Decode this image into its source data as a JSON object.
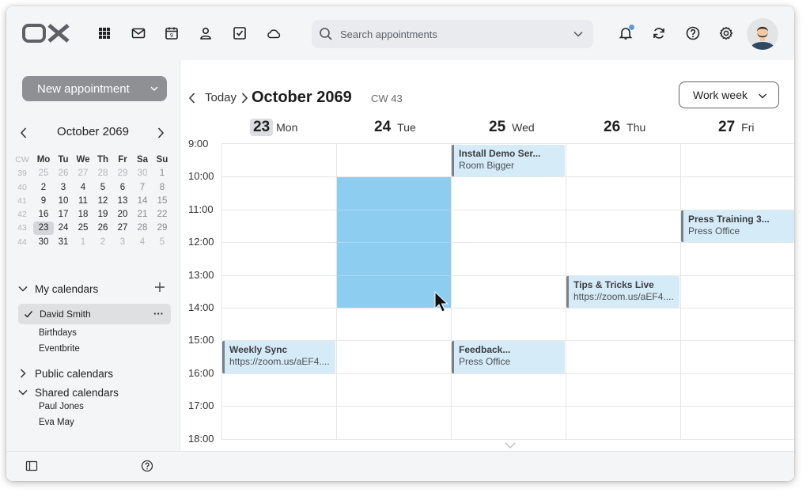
{
  "topbar": {
    "logo_text": "OX",
    "nav_icons": [
      "apps-grid-icon",
      "mail-icon",
      "calendar-icon",
      "contacts-icon",
      "tasks-icon",
      "drive-cloud-icon"
    ],
    "calendar_icon_day": "9",
    "search": {
      "placeholder": "Search appointments"
    },
    "right_icons": [
      "bell-icon",
      "refresh-icon",
      "help-icon",
      "settings-gear-icon"
    ]
  },
  "sidebar": {
    "new_appointment_label": "New appointment",
    "mini_calendar": {
      "title": "October 2069",
      "cw_header": "CW",
      "weekday_headers": [
        "Mo",
        "Tu",
        "We",
        "Th",
        "Fr",
        "Sa",
        "Su"
      ],
      "weeks": [
        {
          "cw": "39",
          "days": [
            "25",
            "26",
            "27",
            "28",
            "29",
            "30",
            "1"
          ]
        },
        {
          "cw": "40",
          "days": [
            "2",
            "3",
            "4",
            "5",
            "6",
            "7",
            "8"
          ]
        },
        {
          "cw": "41",
          "days": [
            "9",
            "10",
            "11",
            "12",
            "13",
            "14",
            "15"
          ]
        },
        {
          "cw": "42",
          "days": [
            "16",
            "17",
            "18",
            "19",
            "20",
            "21",
            "22"
          ]
        },
        {
          "cw": "43",
          "days": [
            "23",
            "24",
            "25",
            "26",
            "27",
            "28",
            "29"
          ]
        },
        {
          "cw": "44",
          "days": [
            "30",
            "31",
            "1",
            "2",
            "3",
            "4",
            "5"
          ]
        }
      ],
      "selected_day": "23"
    },
    "my_calendars": {
      "label": "My calendars",
      "selected": "David Smith",
      "items": [
        "Birthdays",
        "Eventbrite"
      ]
    },
    "public_calendars": {
      "label": "Public calendars"
    },
    "shared_calendars": {
      "label": "Shared calendars",
      "items": [
        "Paul Jones",
        "Eva May"
      ]
    }
  },
  "main": {
    "today_label": "Today",
    "month_title": "October 2069",
    "cw_label": "CW 43",
    "view_label": "Work week",
    "days": [
      {
        "num": "23",
        "wd": "Mon",
        "today": true
      },
      {
        "num": "24",
        "wd": "Tue",
        "today": false
      },
      {
        "num": "25",
        "wd": "Wed",
        "today": false
      },
      {
        "num": "26",
        "wd": "Thu",
        "today": false
      },
      {
        "num": "27",
        "wd": "Fri",
        "today": false
      }
    ],
    "times": [
      "9:00",
      "10:00",
      "11:00",
      "12:00",
      "13:00",
      "14:00",
      "15:00",
      "16:00",
      "17:00",
      "18:00"
    ],
    "events": [
      {
        "title": "Install Demo Ser...",
        "sub": "Room Bigger",
        "day": 2,
        "start": 9,
        "end": 10
      },
      {
        "title": "Press Training 3...",
        "sub": "Press Office",
        "day": 4,
        "start": 11,
        "end": 12
      },
      {
        "title": "Tips & Tricks Live",
        "sub": "https://zoom.us/aEF4....",
        "day": 3,
        "start": 13,
        "end": 14
      },
      {
        "title": "Weekly Sync",
        "sub": "https://zoom.us/aEF4....",
        "day": 0,
        "start": 15,
        "end": 16
      },
      {
        "title": "Feedback...",
        "sub": "Press Office",
        "day": 2,
        "start": 15,
        "end": 16
      }
    ],
    "selection": {
      "day": 1,
      "start": 10,
      "end": 14
    },
    "colors": {
      "event_bg": "#d6ebf8",
      "selection": "#8dcdf0",
      "accent": "#5aa0d8"
    }
  }
}
